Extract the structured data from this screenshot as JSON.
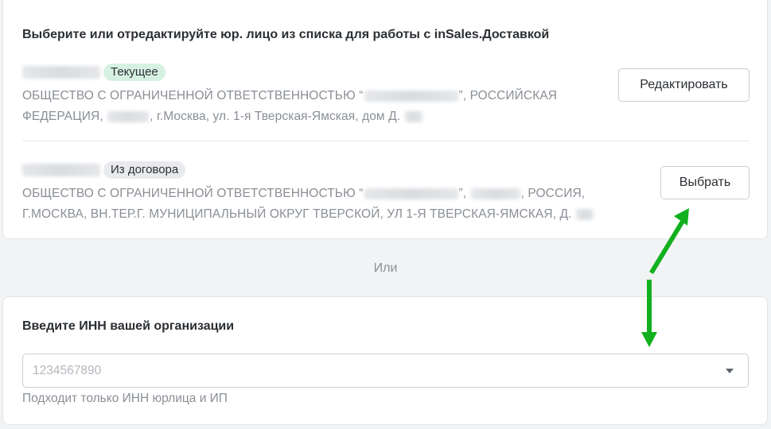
{
  "legal_entities": {
    "title": "Выберите или отредактируйте юр. лицо из списка для работы с inSales.Доставкой",
    "entities": [
      {
        "badge": "Текущее",
        "address_part1": "ОБЩЕСТВО С ОГРАНИЧЕННОЙ ОТВЕТСТВЕННОСТЬЮ “",
        "address_part2": "”, РОССИЙСКАЯ ФЕДЕРАЦИЯ, ",
        "address_part3": ", г.Москва, ул. 1-я Тверская-Ямская, дом Д. ",
        "button_label": "Редактировать"
      },
      {
        "badge": "Из договора",
        "address_part1": "ОБЩЕСТВО С ОГРАНИЧЕННОЙ ОТВЕТСТВЕННОСТЬЮ “",
        "address_part2": "”, ",
        "address_part3": ", РОССИЯ, Г.МОСКВА, ВН.ТЕР.Г. МУНИЦИПАЛЬНЫЙ ОКРУГ ТВЕРСКОЙ, УЛ 1-Я ТВЕРСКАЯ-ЯМСКАЯ, Д. ",
        "button_label": "Выбрать"
      }
    ]
  },
  "separator": {
    "label": "Или"
  },
  "inn_section": {
    "title": "Введите ИНН вашей организации",
    "placeholder": "1234567890",
    "value": "",
    "hint": "Подходит только ИНН юрлица и ИП"
  },
  "colors": {
    "annotation_arrow": "#12b01e",
    "badge_current_bg": "#d6f1e2",
    "badge_contract_bg": "#e9eaed"
  },
  "icons": {
    "dropdown": "chevron-down-icon",
    "annotation": "arrow-icon"
  }
}
